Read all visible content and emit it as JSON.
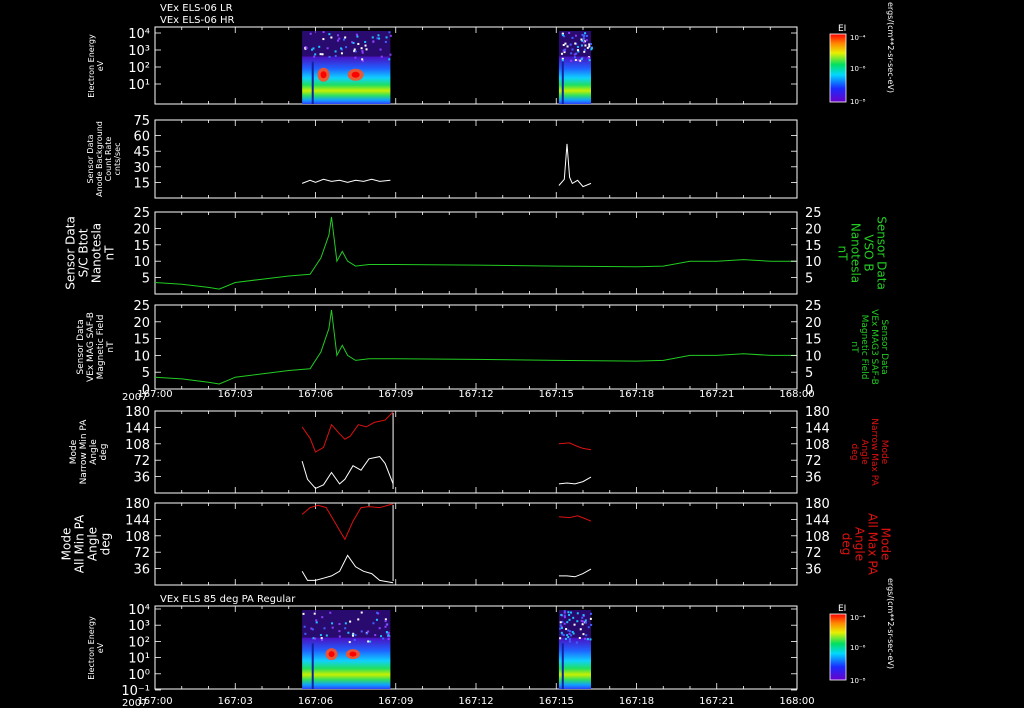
{
  "header": {
    "line1": "VEx ELS-06 LR",
    "line2": "VEx ELS-06 HR",
    "panel7_title": "VEx ELS 85 deg PA Regular",
    "year": "2007"
  },
  "time_axis": {
    "ticks": [
      "167:00",
      "167:03",
      "167:06",
      "167:09",
      "167:12",
      "167:15",
      "167:18",
      "167:21",
      "168:00"
    ]
  },
  "colorbar": {
    "title": "EI",
    "units": "ergs/(cm**2-sr-sec-eV)",
    "top_label": "10⁻⁴",
    "mid_label": "10⁻⁶",
    "bottom_label": "10⁻⁸"
  },
  "panels": {
    "p1": {
      "ylabel": [
        "Electron Energy",
        "eV"
      ]
    },
    "p2": {
      "ylabel": [
        "Sensor Data",
        "Anode Background",
        "Count Rate",
        "cnts/sec"
      ]
    },
    "p3": {
      "ylabel": [
        "Sensor Data",
        "S/C Btot",
        "Nanotesla",
        "nT"
      ],
      "ylabel_right": [
        "Sensor Data",
        "VSO B",
        "Nanotesla",
        "nT"
      ]
    },
    "p4": {
      "ylabel": [
        "Sensor Data",
        "VEx MAG SAF-B",
        "Magnetic Field",
        "nT"
      ],
      "ylabel_right": [
        "Sensor Data",
        "VEx MAG3 SAF-B",
        "Magnetic Field",
        "nT"
      ]
    },
    "p5": {
      "ylabel": [
        "Mode",
        "Narrow Min PA",
        "Angle",
        "deg"
      ],
      "ylabel_right": [
        "Mode",
        "Narrow Max PA",
        "Angle",
        "deg"
      ]
    },
    "p6": {
      "ylabel": [
        "Mode",
        "All Min PA",
        "Angle",
        "deg"
      ],
      "ylabel_right": [
        "Mode",
        "All Max PA",
        "Angle",
        "deg"
      ]
    },
    "p7": {
      "ylabel": [
        "Electron Energy",
        "eV"
      ]
    }
  },
  "colors": {
    "background": "#000000",
    "axis": "#ffffff",
    "btot": "#22cc22",
    "max_pa": "#dd1111",
    "min_pa": "#ffffff",
    "right_green_label": "#22cc22",
    "right_red_label": "#dd1111"
  },
  "chart_data": [
    {
      "type": "heatmap",
      "panel": "p1",
      "xlabel": "",
      "ylabel": "Electron Energy (eV)",
      "ylog": true,
      "ytick_labels": [
        "10⁴",
        "10³",
        "10²",
        "10¹"
      ],
      "x_range": [
        "167:00",
        "168:00"
      ],
      "data_intervals": [
        [
          "167:05.5",
          "167:08.8"
        ],
        [
          "167:15.1",
          "167:16.3"
        ]
      ],
      "colorbar_range": [
        "10⁻⁸",
        "10⁻⁴"
      ]
    },
    {
      "type": "line",
      "panel": "p2",
      "ylim": [
        0,
        75
      ],
      "ytick_labels": [
        "75",
        "60",
        "45",
        "30",
        "15"
      ],
      "series": [
        {
          "x_min": [
            5.5,
            5.8,
            6.0,
            6.3,
            6.6,
            6.9,
            7.2,
            7.5,
            7.8,
            8.1,
            8.4,
            8.8
          ],
          "y": [
            14,
            17,
            15,
            18,
            16,
            17,
            15,
            17,
            16,
            18,
            16,
            17
          ]
        },
        {
          "x_min": [
            15.1,
            15.3,
            15.4,
            15.5,
            15.6,
            15.8,
            16.0,
            16.3
          ],
          "y": [
            12,
            18,
            52,
            20,
            14,
            17,
            11,
            14
          ]
        }
      ]
    },
    {
      "type": "line",
      "panel": "p3",
      "ylim": [
        0,
        25
      ],
      "ytick_labels": [
        "25",
        "20",
        "15",
        "10",
        "5"
      ],
      "series": [
        {
          "x_min": [
            0,
            1,
            2,
            2.4,
            3,
            4,
            5,
            5.8,
            6.2,
            6.5,
            6.6,
            6.8,
            7.0,
            7.2,
            7.5,
            8,
            9,
            12,
            15,
            18,
            19,
            20,
            21,
            22,
            23,
            24
          ],
          "y": [
            3.5,
            3.0,
            2.0,
            1.5,
            3.5,
            4.5,
            5.5,
            6.0,
            11,
            18,
            23.5,
            10,
            13,
            10,
            8.5,
            9,
            9,
            8.8,
            8.5,
            8.3,
            8.5,
            10,
            10,
            10.5,
            10,
            10
          ]
        }
      ]
    },
    {
      "type": "line",
      "panel": "p4",
      "ylim": [
        0,
        25
      ],
      "ytick_labels": [
        "25",
        "20",
        "15",
        "10",
        "5",
        "0"
      ],
      "series": [
        {
          "x_min": [
            0,
            1,
            2,
            2.4,
            3,
            4,
            5,
            5.8,
            6.2,
            6.5,
            6.6,
            6.8,
            7.0,
            7.2,
            7.5,
            8,
            9,
            12,
            15,
            18,
            19,
            20,
            21,
            22,
            23,
            24
          ],
          "y": [
            3.5,
            3.0,
            2.0,
            1.5,
            3.5,
            4.5,
            5.5,
            6.0,
            11,
            18,
            23.5,
            10,
            13,
            10,
            8.5,
            9,
            9,
            8.8,
            8.5,
            8.3,
            8.5,
            10,
            10,
            10.5,
            10,
            10
          ]
        }
      ]
    },
    {
      "type": "line",
      "panel": "p5",
      "ylim": [
        0,
        180
      ],
      "ytick_labels": [
        "180",
        "144",
        "108",
        "72",
        "36"
      ],
      "series": [
        {
          "name": "max",
          "segments": [
            {
              "x_min": [
                5.5,
                5.8,
                6.0,
                6.3,
                6.6,
                6.9,
                7.1,
                7.3,
                7.6,
                7.9,
                8.2,
                8.6,
                8.9
              ],
              "y": [
                145,
                120,
                90,
                100,
                150,
                130,
                118,
                125,
                150,
                145,
                155,
                160,
                178
              ]
            },
            {
              "x_min": [
                15.1,
                15.5,
                15.8,
                16.0,
                16.3
              ],
              "y": [
                108,
                110,
                102,
                98,
                95
              ]
            }
          ]
        },
        {
          "name": "min",
          "segments": [
            {
              "x_min": [
                5.5,
                5.7,
                6.0,
                6.3,
                6.6,
                6.9,
                7.1,
                7.4,
                7.7,
                8.0,
                8.4,
                8.6,
                8.9
              ],
              "y": [
                70,
                30,
                10,
                18,
                45,
                20,
                30,
                60,
                50,
                75,
                80,
                65,
                20
              ]
            },
            {
              "x_min": [
                15.1,
                15.4,
                15.7,
                16.0,
                16.3
              ],
              "y": [
                20,
                22,
                20,
                25,
                35
              ]
            }
          ]
        }
      ]
    },
    {
      "type": "line",
      "panel": "p6",
      "ylim": [
        0,
        180
      ],
      "ytick_labels": [
        "180",
        "144",
        "108",
        "72",
        "36"
      ],
      "series": [
        {
          "name": "max",
          "segments": [
            {
              "x_min": [
                5.5,
                5.8,
                6.1,
                6.4,
                6.8,
                7.1,
                7.4,
                7.7,
                8.0,
                8.4,
                8.9
              ],
              "y": [
                155,
                170,
                175,
                170,
                130,
                100,
                140,
                170,
                172,
                170,
                178
              ]
            },
            {
              "x_min": [
                15.1,
                15.5,
                15.8,
                16.1,
                16.3
              ],
              "y": [
                150,
                148,
                152,
                145,
                140
              ]
            }
          ]
        },
        {
          "name": "min",
          "segments": [
            {
              "x_min": [
                5.5,
                5.7,
                6.0,
                6.3,
                6.6,
                6.9,
                7.2,
                7.5,
                7.8,
                8.1,
                8.4,
                8.9
              ],
              "y": [
                30,
                10,
                10,
                15,
                20,
                30,
                65,
                40,
                30,
                25,
                10,
                5
              ]
            },
            {
              "x_min": [
                15.1,
                15.4,
                15.7,
                16.0,
                16.3
              ],
              "y": [
                20,
                20,
                18,
                25,
                35
              ]
            }
          ]
        }
      ]
    },
    {
      "type": "heatmap",
      "panel": "p7",
      "xlabel": "",
      "ylabel": "Electron Energy (eV)",
      "ylog": true,
      "ytick_labels": [
        "10⁴",
        "10³",
        "10²",
        "10¹",
        "10⁰",
        "10⁻¹"
      ],
      "x_range": [
        "167:00",
        "168:00"
      ],
      "data_intervals": [
        [
          "167:05.5",
          "167:08.8"
        ],
        [
          "167:15.1",
          "167:16.3"
        ]
      ],
      "colorbar_range": [
        "10⁻⁸",
        "10⁻⁴"
      ]
    }
  ]
}
